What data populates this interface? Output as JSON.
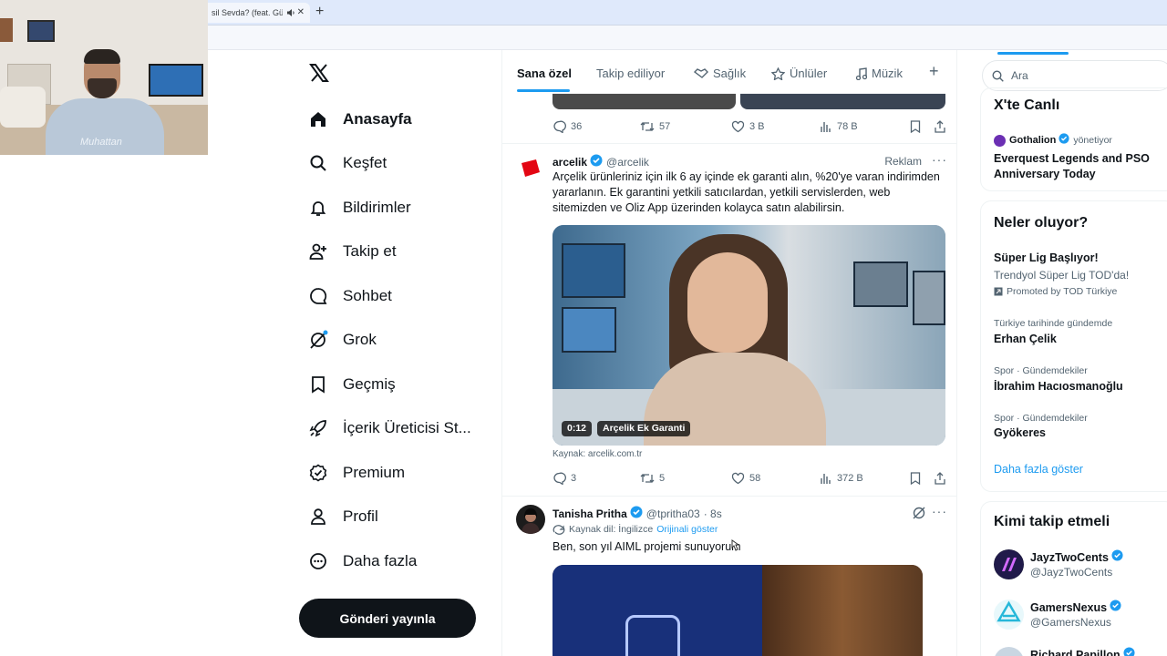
{
  "browser": {
    "tab_title": "sil Sevda? (feat. Gülce",
    "speaker_icon": "speaker-icon",
    "close_icon": "close-icon",
    "new_tab_icon": "plus-icon"
  },
  "webcam": {
    "shirt_text": "Muhattan"
  },
  "sidebar": {
    "items": [
      {
        "label": "Anasayfa",
        "icon": "home-icon",
        "active": true
      },
      {
        "label": "Keşfet",
        "icon": "search-icon"
      },
      {
        "label": "Bildirimler",
        "icon": "bell-icon"
      },
      {
        "label": "Takip et",
        "icon": "follow-icon"
      },
      {
        "label": "Sohbet",
        "icon": "chat-icon"
      },
      {
        "label": "Grok",
        "icon": "grok-icon"
      },
      {
        "label": "Geçmiş",
        "icon": "bookmark-icon"
      },
      {
        "label": "İçerik Üreticisi St...",
        "icon": "rocket-icon"
      },
      {
        "label": "Premium",
        "icon": "premium-icon"
      },
      {
        "label": "Profil",
        "icon": "profile-icon"
      },
      {
        "label": "Daha fazla",
        "icon": "more-icon"
      }
    ],
    "post_button": "Gönderi yayınla"
  },
  "tabs": [
    {
      "label": "Sana özel",
      "active": true
    },
    {
      "label": "Takip ediliyor"
    },
    {
      "label": "Sağlık",
      "icon": "handshake-icon"
    },
    {
      "label": "Ünlüler",
      "icon": "star-icon"
    },
    {
      "label": "Müzik",
      "icon": "music-icon"
    }
  ],
  "prev_tweet_actions": {
    "replies": "36",
    "reposts": "57",
    "likes": "3 B",
    "views": "78 B"
  },
  "ad_tweet": {
    "name": "arcelik",
    "handle": "@arcelik",
    "label": "Reklam",
    "more": "···",
    "text": "Arçelik ürünleriniz için ilk 6 ay içinde ek garanti alın, %20'ye varan indirimden yararlanın. Ek garantini yetkili satıcılardan, yetkili servislerden, web sitemizden ve Oliz App üzerinden kolayca satın alabilirsin.",
    "video_time": "0:12",
    "video_title": "Arçelik Ek Garanti",
    "source": "Kaynak: arcelik.com.tr",
    "actions": {
      "replies": "3",
      "reposts": "5",
      "likes": "58",
      "views": "372 B"
    }
  },
  "tweet2": {
    "name": "Tanisha Pritha",
    "handle": "@tpritha03",
    "time": "· 8s",
    "more": "···",
    "translate_label": "Kaynak dil: İngilizce",
    "translate_link": "Orijinali göster",
    "text": "Ben, son yıl AIML projemi sunuyorum"
  },
  "right": {
    "search_placeholder": "Ara",
    "live": {
      "title": "X'te Canlı",
      "host": "Gothalion",
      "host_status": "yönetiyor",
      "stream_title": "Everquest Legends and PSO Anniversary Today"
    },
    "trends": {
      "title": "Neler oluyor?",
      "items": [
        {
          "title": "Süper Lig Başlıyor!",
          "subtitle": "Trendyol Süper Lig TOD'da!",
          "promo": "Promoted by TOD Türkiye"
        },
        {
          "context": "Türkiye tarihinde gündemde",
          "title": "Erhan Çelik"
        },
        {
          "context": "Spor · Gündemdekiler",
          "title": "İbrahim Hacıosmanoğlu"
        },
        {
          "context": "Spor · Gündemdekiler",
          "title": "Gyökeres"
        }
      ],
      "show_more": "Daha fazla göster"
    },
    "who_to_follow": {
      "title": "Kimi takip etmeli",
      "items": [
        {
          "name": "JayzTwoCents",
          "handle": "@JayzTwoCents"
        },
        {
          "name": "GamersNexus",
          "handle": "@GamersNexus"
        },
        {
          "name": "Richard Papillon",
          "handle": ""
        }
      ]
    }
  },
  "colors": {
    "accent": "#1d9bf0",
    "text": "#0f1419",
    "muted": "#536471",
    "arcelik": "#e30613"
  }
}
